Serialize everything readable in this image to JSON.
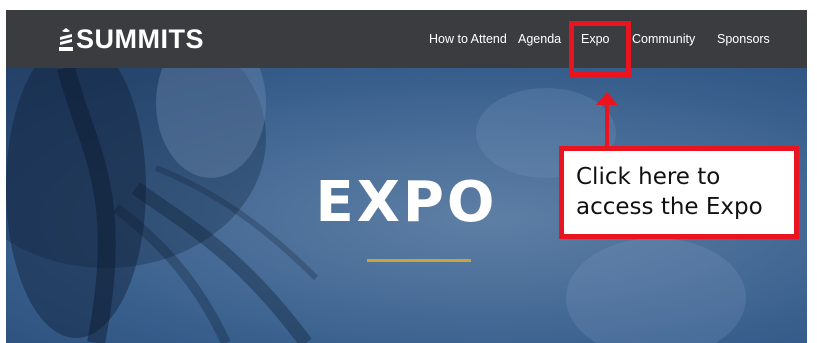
{
  "site": {
    "logo_text": "SUMMITS"
  },
  "nav": {
    "items": [
      {
        "label": "How to Attend"
      },
      {
        "label": "Agenda"
      },
      {
        "label": "Expo"
      },
      {
        "label": "Community"
      },
      {
        "label": "Sponsors"
      }
    ]
  },
  "hero": {
    "title": "EXPO"
  },
  "callout": {
    "line1": "Click here to",
    "line2": "access the Expo"
  },
  "colors": {
    "navbar": "#3a3c3f",
    "hero": "#365d8b",
    "accent_underline": "#c9a43a",
    "annotation": "#e8141f"
  }
}
